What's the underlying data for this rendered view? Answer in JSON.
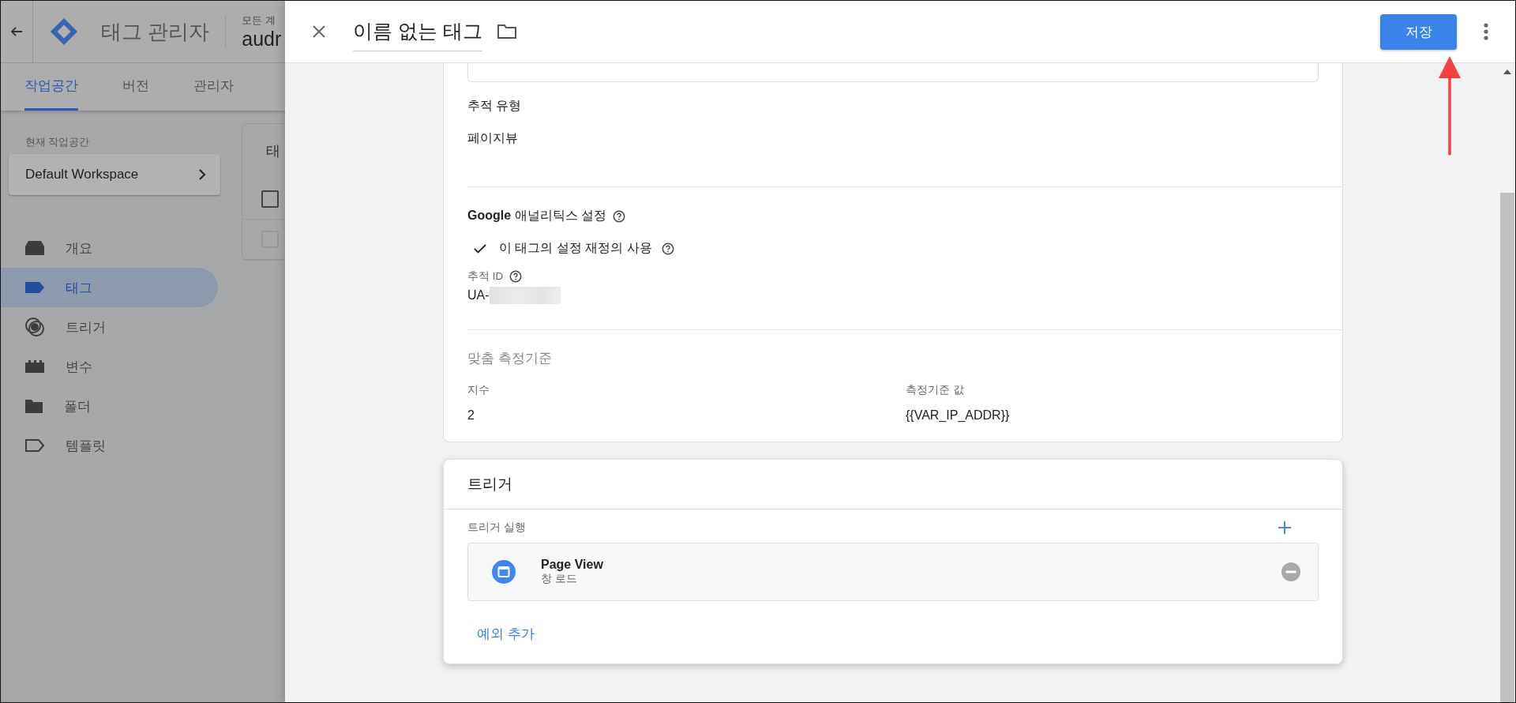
{
  "header": {
    "product": "태그 관리자",
    "account_label": "모든 계",
    "container_name": "audr"
  },
  "tabs": [
    {
      "label": "작업공간",
      "selected": true
    },
    {
      "label": "버전",
      "selected": false
    },
    {
      "label": "관리자",
      "selected": false
    }
  ],
  "sidebar": {
    "workspace_label": "현재 작업공간",
    "workspace": "Default Workspace",
    "items": [
      {
        "label": "개요",
        "kind": "overview",
        "selected": false
      },
      {
        "label": "태그",
        "kind": "tag",
        "selected": true
      },
      {
        "label": "트리거",
        "kind": "trigger",
        "selected": false
      },
      {
        "label": "변수",
        "kind": "variable",
        "selected": false
      },
      {
        "label": "폴더",
        "kind": "folder",
        "selected": false
      },
      {
        "label": "템플릿",
        "kind": "template",
        "selected": false
      }
    ]
  },
  "list_card": {
    "title": "태",
    "rows": [
      {
        "checked": false,
        "disabled": false
      },
      {
        "checked": false,
        "disabled": true
      }
    ]
  },
  "panel": {
    "title": "이름 없는 태그",
    "save": "저장"
  },
  "config": {
    "tracking_type_label": "추적 유형",
    "tracking_type": "페이지뷰",
    "ga_settings_label": "**Google** 애널리틱스 설정",
    "override": {
      "label": "이 태그의 설정 재정의 사용",
      "checked": true
    },
    "tracking_id_label": "추적 ID",
    "tracking_id": "UA-",
    "custom_dimensions": {
      "title": "맞춤 측정기준",
      "columns": [
        "지수",
        "측정기준 값"
      ],
      "rows": [
        [
          "2",
          "{{VAR_IP_ADDR}}"
        ]
      ]
    }
  },
  "triggering": {
    "title": "트리거",
    "label": "트리거 실행",
    "triggers": [
      {
        "name": "Page View",
        "type": "창 로드"
      }
    ],
    "add_exception": "예외 추가"
  }
}
